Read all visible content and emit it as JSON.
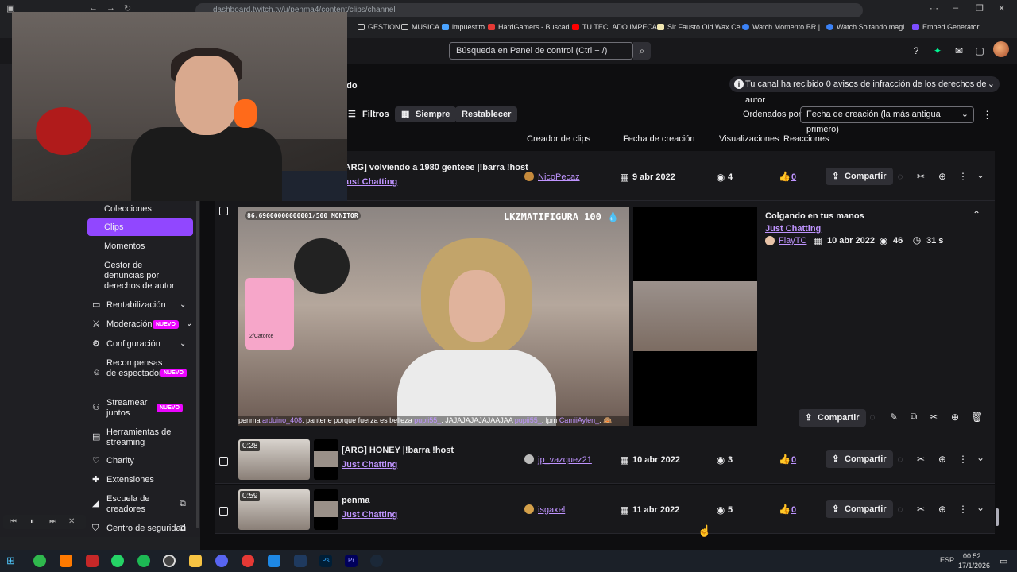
{
  "browser": {
    "url": "dashboard.twitch.tv/u/penma4/content/clips/channel",
    "bookmarks": [
      "GESTION",
      "MUSICA",
      "impuestito",
      "HardGamers - Buscad...",
      "TU TECLADO IMPECA...",
      "Sir Fausto Old Wax Ce...",
      "Watch Momento BR | ...",
      "Watch Soltando magi...",
      "Embed Generator"
    ]
  },
  "topnav": {
    "search_placeholder": "Búsqueda en Panel de control (Ctrl + /)"
  },
  "sidebar": {
    "sub_items": [
      "Colecciones",
      "Clips",
      "Momentos",
      "Gestor de denuncias por derechos de autor"
    ],
    "items": [
      {
        "label": "Rentabilización",
        "icon": "monetization-icon"
      },
      {
        "label": "Moderación",
        "icon": "sword-icon",
        "badge": "NUEVO"
      },
      {
        "label": "Configuración",
        "icon": "gear-icon"
      },
      {
        "label": "Recompensas de espectador",
        "icon": "smile-icon",
        "badge": "NUEVO"
      },
      {
        "label": "Streamear juntos",
        "icon": "people-icon",
        "badge": "NUEVO"
      },
      {
        "label": "Herramientas de streaming",
        "icon": "tools-icon"
      },
      {
        "label": "Charity",
        "icon": "heart-icon"
      },
      {
        "label": "Extensiones",
        "icon": "puzzle-icon"
      },
      {
        "label": "Escuela de creadores",
        "icon": "megaphone-icon"
      },
      {
        "label": "Centro de seguridad",
        "icon": "shield-icon"
      }
    ]
  },
  "page": {
    "heading_partial": "ado",
    "notice": "Tu canal ha recibido 0 avisos de infracción de los derechos de autor",
    "filters_label": "Filtros",
    "range_label": "Siempre",
    "reset_label": "Restablecer",
    "sort_label": "Ordenados por",
    "sort_value": "Fecha de creación (la más antigua primero)",
    "columns": [
      "Creador de clips",
      "Fecha de creación",
      "Visualizaciones",
      "Reacciones"
    ]
  },
  "clips": [
    {
      "title": "[ARG] volviendo a 1980 genteee |!barra !host",
      "category": "Just Chatting",
      "creator": "NicoPecaz",
      "date": "9 abr 2022",
      "views": "4",
      "reactions": "0"
    },
    {
      "title": "[ARG] HONEY |!barra !host",
      "category": "Just Chatting",
      "creator": "jp_vazquez21",
      "date": "10 abr 2022",
      "views": "3",
      "reactions": "0",
      "duration": "0:28"
    },
    {
      "title": "penma",
      "category": "Just Chatting",
      "creator": "isgaxel",
      "date": "11 abr 2022",
      "views": "5",
      "reactions": "0",
      "duration": "0:59"
    }
  ],
  "expanded_clip": {
    "title": "Colgando en tus manos",
    "category": "Just Chatting",
    "creator": "FlayTC",
    "date": "10 abr 2022",
    "views": "46",
    "duration": "31 s",
    "overlay_goal": "86.69000000000001/500 MONITOR",
    "overlay_brand": "LKZMATIFIGURA 100 💧",
    "card_text": "2/Catorce",
    "chat": [
      "penma",
      "arduino_408",
      ": pantene porque fuerza es belleza ",
      "pupii55_",
      ": JAJAJAJAJAJAAJAA ",
      "pupii55_",
      ": lpm ",
      "CamiiAylen_",
      ": 🙈"
    ]
  },
  "share_label": "Compartir",
  "taskbar": {
    "lang": "ESP",
    "time": "00:52",
    "date": "17/1/2026"
  }
}
